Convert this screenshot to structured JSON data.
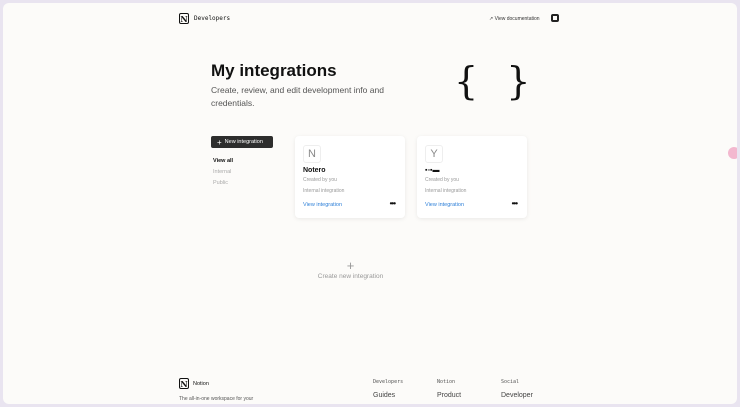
{
  "header": {
    "brand": "Developers",
    "view_docs": "View documentation"
  },
  "hero": {
    "title": "My integrations",
    "subtitle": "Create, review, and edit development info and credentials.",
    "braces": "{ }"
  },
  "sidebar": {
    "new_button": "New integration",
    "filters": [
      "View all",
      "Internal",
      "Public"
    ]
  },
  "cards": [
    {
      "avatar": "N",
      "name": "Notero",
      "created": "Created by you",
      "type": "Internal integration",
      "link": "View integration"
    },
    {
      "avatar": "Y",
      "name": "▪▫▪▬",
      "created": "Created by you",
      "type": "Internal integration",
      "link": "View integration"
    }
  ],
  "create_new": {
    "icon": "+",
    "label": "Create new integration"
  },
  "footer": {
    "brand": "Notion",
    "tagline": "The all-in-one workspace for your",
    "columns": [
      {
        "heading": "Developers",
        "item": "Guides"
      },
      {
        "heading": "Notion",
        "item": "Product"
      },
      {
        "heading": "Social",
        "item": "Developer"
      }
    ]
  }
}
